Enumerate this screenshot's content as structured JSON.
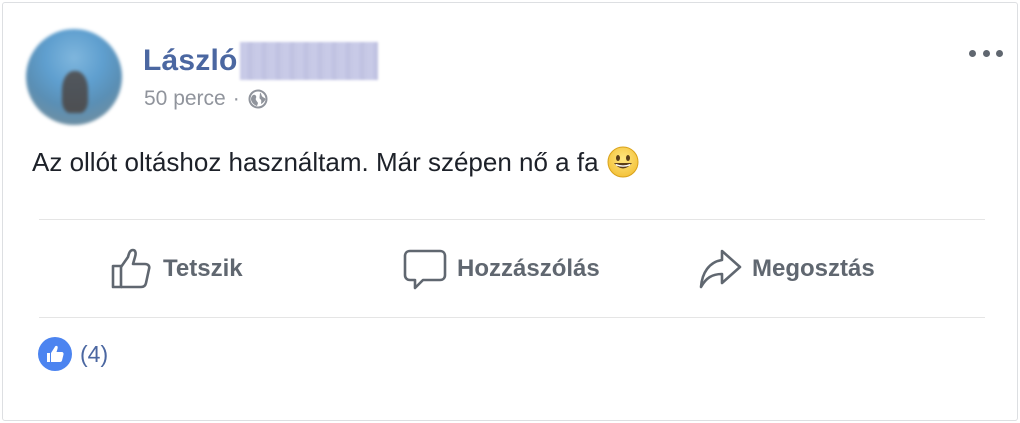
{
  "post": {
    "author": {
      "first_name": "László",
      "avatar_icon": "profile-photo-blurred"
    },
    "time_ago": "50 perce",
    "separator": "·",
    "privacy_icon": "globe-icon",
    "menu_icon": "more-options-icon",
    "text": "Az ollót oltáshoz használtam. Már szépen nő a fa",
    "emoji_icon": "grinning-face-icon"
  },
  "actions": {
    "like_label": "Tetszik",
    "comment_label": "Hozzászólás",
    "share_label": "Megosztás"
  },
  "reactions": {
    "count_text": "(4)",
    "icon": "thumbs-up-icon"
  },
  "colors": {
    "author_link": "#4b67a1",
    "meta_gray": "#90949c",
    "action_gray": "#606770",
    "like_blue": "#4c84f0",
    "divider": "#e5e5e5"
  }
}
